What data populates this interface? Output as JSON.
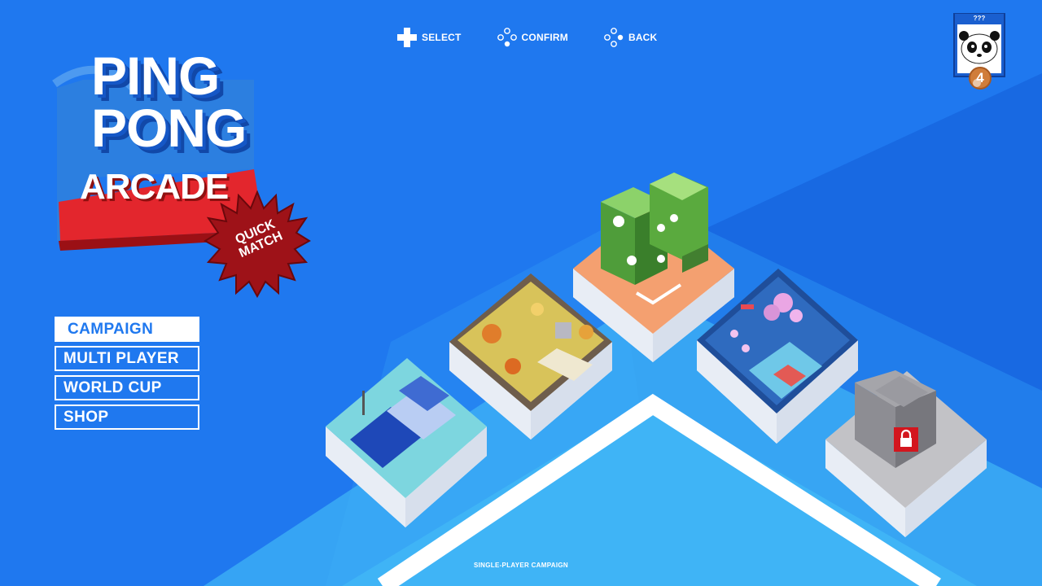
{
  "controls": {
    "select_label": "SELECT",
    "confirm_label": "CONFIRM",
    "back_label": "BACK"
  },
  "logo": {
    "line1": "PING",
    "line2": "PONG",
    "line3": "ARCADE",
    "badge_line1": "QUICK",
    "badge_line2": "MATCH"
  },
  "menu": {
    "items": [
      {
        "label": "CAMPAIGN",
        "selected": true
      },
      {
        "label": "MULTI PLAYER",
        "selected": false
      },
      {
        "label": "WORLD CUP",
        "selected": false
      },
      {
        "label": "SHOP",
        "selected": false
      }
    ]
  },
  "player": {
    "rank_label": "???",
    "level": "4"
  },
  "footer": {
    "description": "SINGLE-PLAYER CAMPAIGN"
  },
  "colors": {
    "background": "#1f78ef",
    "accent_red": "#c8161d",
    "floor_light": "#3fb6f5"
  },
  "icons": [
    "dpad-icon",
    "button-cluster-icon",
    "padlock-icon",
    "panda-avatar-icon"
  ]
}
